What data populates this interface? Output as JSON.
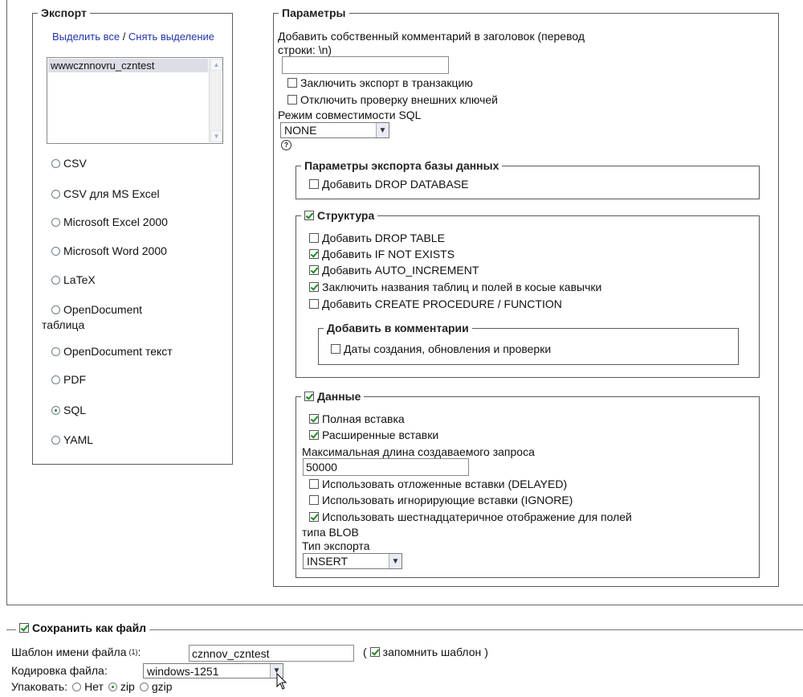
{
  "export": {
    "legend": "Экспорт",
    "select_all": "Выделить все",
    "separator": " / ",
    "deselect": "Снять выделение",
    "databases": [
      "wwwcznnovru_czntest"
    ],
    "formats": [
      {
        "label": "CSV",
        "checked": false
      },
      {
        "label": "CSV для MS Excel",
        "checked": false
      },
      {
        "label": "Microsoft Excel 2000",
        "checked": false
      },
      {
        "label": "Microsoft Word 2000",
        "checked": false
      },
      {
        "label": "LaTeX",
        "checked": false
      },
      {
        "label": "OpenDocument",
        "label2": "таблица",
        "checked": false
      },
      {
        "label": "OpenDocument текст",
        "checked": false
      },
      {
        "label": "PDF",
        "checked": false
      },
      {
        "label": "SQL",
        "checked": true
      },
      {
        "label": "YAML",
        "checked": false
      }
    ]
  },
  "params": {
    "legend": "Параметры",
    "comment_label_1": "Добавить собственный комментарий в заголовок (перевод",
    "comment_label_2": "строки: \\n)",
    "comment_value": "",
    "transaction": {
      "label": "Заключить экспорт в транзакцию",
      "checked": false
    },
    "foreign_keys": {
      "label": "Отключить проверку внешних ключей",
      "checked": false
    },
    "compat_label": "Режим совместимости SQL",
    "compat_value": "NONE",
    "help_glyph": "?"
  },
  "db_params": {
    "legend": "Параметры экспорта базы данных",
    "drop_database": {
      "label": "Добавить DROP DATABASE",
      "checked": false
    }
  },
  "structure": {
    "legend": "Структура",
    "checked": true,
    "options": [
      {
        "label": "Добавить DROP TABLE",
        "checked": false
      },
      {
        "label": "Добавить IF NOT EXISTS",
        "checked": true
      },
      {
        "label": "Добавить AUTO_INCREMENT",
        "checked": true
      },
      {
        "label": "Заключить названия таблиц и полей в косые кавычки",
        "checked": true
      },
      {
        "label": "Добавить CREATE PROCEDURE / FUNCTION",
        "checked": false
      }
    ],
    "comments_legend": "Добавить в комментарии",
    "dates": {
      "label": "Даты создания, обновления и проверки",
      "checked": false
    }
  },
  "data": {
    "legend": "Данные",
    "checked": true,
    "complete_insert": {
      "label": "Полная вставка",
      "checked": true
    },
    "extended_insert": {
      "label": "Расширенные вставки",
      "checked": true
    },
    "max_query_label": "Максимальная длина создаваемого запроса",
    "max_query_value": "50000",
    "delayed": {
      "label": "Использовать отложенные вставки (DELAYED)",
      "checked": false
    },
    "ignore": {
      "label": "Использовать игнорирующие вставки (IGNORE)",
      "checked": false
    },
    "hex": {
      "label": "Использовать шестнадцатеричное отображение для полей",
      "label2": "типа BLOB",
      "checked": true
    },
    "export_type_label": "Тип экспорта",
    "export_type_value": "INSERT"
  },
  "save": {
    "legend": "Сохранить как файл",
    "checked": true,
    "template_label": "Шаблон имени файла",
    "template_sup": "(1)",
    "template_colon": ":",
    "template_value": "cznnov_czntest",
    "remember_open": "(",
    "remember_label": "запомнить шаблон",
    "remember_close": ")",
    "remember_checked": true,
    "encoding_label": "Кодировка файла:",
    "encoding_value": "windows-1251",
    "pack_label": "Упаковать:",
    "pack_options": [
      {
        "label": "Нет",
        "checked": false
      },
      {
        "label": "zip",
        "checked": true
      },
      {
        "label": "gzip",
        "checked": false
      }
    ]
  }
}
